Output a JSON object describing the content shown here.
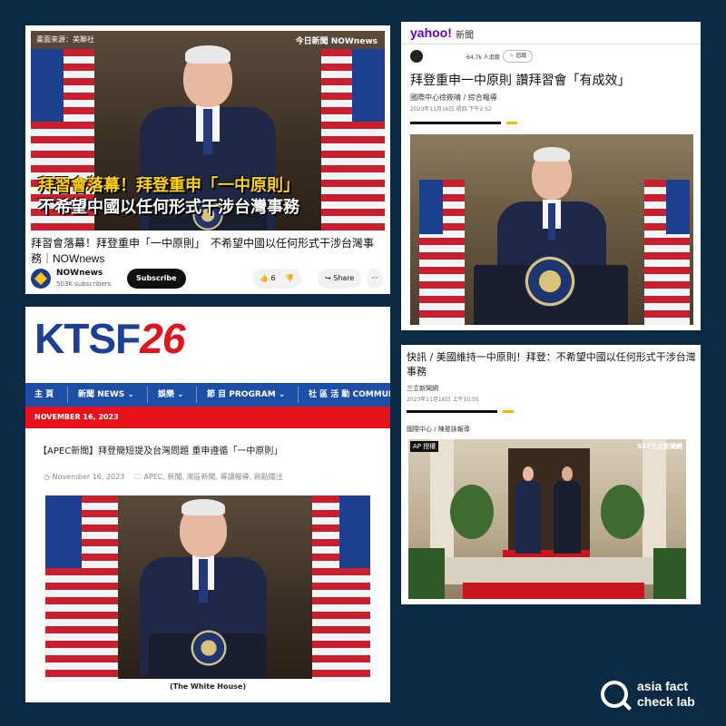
{
  "panel_youtube": {
    "overlay_source": "畫面來源：美聯社",
    "overlay_logo": "今日新聞 NOWnews",
    "caption_line1": "拜習會落幕！拜登重申「一中原則」",
    "caption_line2": "不希望中國以任何形式干涉台灣事務",
    "title_line1": "拜習會落幕！拜登重申「一中原則」　不希望中國以任何形式干涉台灣事",
    "title_line2": "務｜NOWnews",
    "channel_name": "NOWnews",
    "subscribers": "503K subscribers",
    "subscribe_label": "Subscribe",
    "like_count": "6",
    "share_label": "Share",
    "more_label": "···"
  },
  "panel_yahoo": {
    "brand": "yahoo!",
    "brand_sub": "新聞",
    "publisher_followers": "64.7k 人追蹤",
    "follow_label": "☆ 追蹤",
    "headline": "拜登重申一中原則 讚拜習會「有成效」",
    "byline": "國際中心徐筱晴 / 綜合報導",
    "date": "2023年11月16日 週四 下午2:52"
  },
  "panel_ktsf": {
    "logo_letters": "KTSF",
    "logo_number": "26",
    "nav": [
      "主 頁",
      "新聞 NEWS ⌄",
      "娛樂 ⌄",
      "節 目 PROGRAM ⌄",
      "社 區 活 動 COMMUN"
    ],
    "date_bar": "NOVEMBER 16, 2023",
    "headline": "【APEC新聞】拜登簡短提及台灣問題 重申遵循「一中原則」",
    "meta_date": "November 16, 2023",
    "meta_tags": "APEC, 新聞, 灣區新聞, 導讀報導, 熱點關注",
    "credit": "(The White House)"
  },
  "panel_sanli": {
    "headline": "快訊 / 美國維持一中原則！拜登：不希望中國以任何形式干涉台灣事務",
    "source": "三立新聞網",
    "date": "2023年11月16日 上午10:05",
    "reporter": "國際中心 / 陳晏詠報導",
    "ap_tag": "AP 授權",
    "set_tag": "SET三立新聞網"
  },
  "brand_logo": {
    "line1": "asia fact",
    "line2": "check lab"
  },
  "colors": {
    "background": "#0d2a45",
    "ktsf_blue": "#1d4fa6",
    "ktsf_red": "#e8121c",
    "yahoo_purple": "#6001d2",
    "caption_yellow": "#ffd400"
  }
}
